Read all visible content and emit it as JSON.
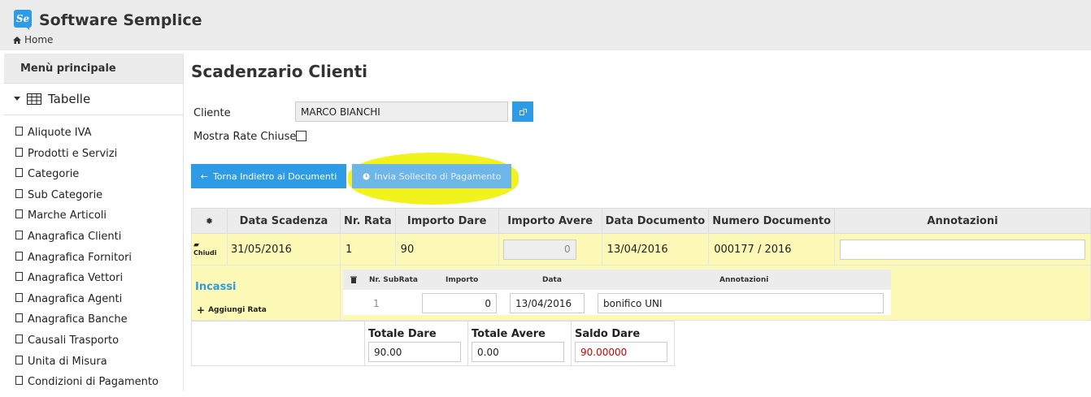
{
  "app": {
    "title": "Software Semplice",
    "logo_text": "Se",
    "breadcrumb": "Home"
  },
  "sidebar": {
    "header": "Menù principale",
    "section": "Tabelle",
    "items": [
      {
        "label": "Aliquote IVA"
      },
      {
        "label": "Prodotti e Servizi"
      },
      {
        "label": "Categorie"
      },
      {
        "label": "Sub Categorie"
      },
      {
        "label": "Marche Articoli"
      },
      {
        "label": "Anagrafica Clienti"
      },
      {
        "label": "Anagrafica Fornitori"
      },
      {
        "label": "Anagrafica Vettori"
      },
      {
        "label": "Anagrafica Agenti"
      },
      {
        "label": "Anagrafica Banche"
      },
      {
        "label": "Causali Trasporto"
      },
      {
        "label": "Unita di Misura"
      },
      {
        "label": "Condizioni di Pagamento"
      }
    ]
  },
  "page": {
    "title": "Scadenzario Clienti",
    "cliente_label": "Cliente",
    "cliente_value": "MARCO BIANCHI",
    "mostra_label": "Mostra Rate Chiuse",
    "back_button": "Torna Indietro ai Documenti",
    "sollecito_button": "Invia Sollecito di Pagamento"
  },
  "table": {
    "headers": [
      "Data Scadenza",
      "Nr. Rata",
      "Importo Dare",
      "Importo Avere",
      "Data Documento",
      "Numero Documento",
      "Annotazioni"
    ],
    "row": {
      "close_label": "Chiudi",
      "data_scadenza": "31/05/2016",
      "nr_rata": "1",
      "importo_dare": "90",
      "importo_avere": "0",
      "data_documento": "13/04/2016",
      "numero_documento": "000177 / 2016",
      "annotazioni": ""
    },
    "incassi": {
      "title": "Incassi",
      "add_label": "Aggiungi Rata",
      "headers": [
        "Nr. SubRata",
        "Importo",
        "Data",
        "Annotazioni"
      ],
      "row": {
        "nr": "1",
        "importo": "0",
        "data": "13/04/2016",
        "annotazioni": "bonifico UNI"
      }
    },
    "totals": {
      "dare_label": "Totale Dare",
      "dare_value": "90.00",
      "avere_label": "Totale Avere",
      "avere_value": "0.00",
      "saldo_label": "Saldo Dare",
      "saldo_value": "90.00000",
      "saldo_color": "#cc0000"
    }
  },
  "colors": {
    "accent": "#2d9be6",
    "row_highlight": "#fcf8b5",
    "annotation_highlight": "#f2f21e"
  }
}
